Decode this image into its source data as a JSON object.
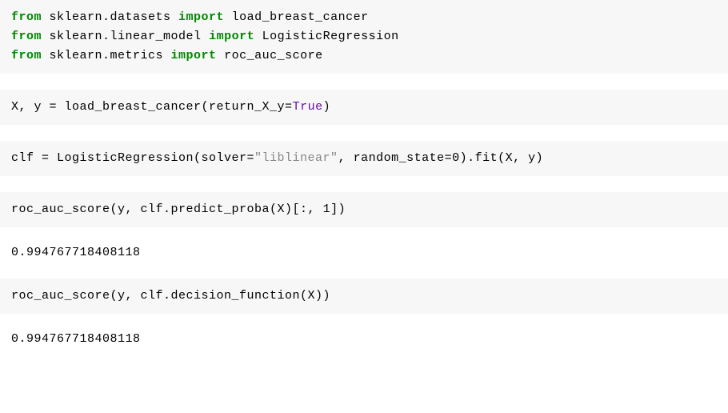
{
  "cell1": {
    "line1": {
      "kw_from1": "from",
      "mod1": " sklearn.datasets ",
      "kw_import1": "import",
      "name1": " load_breast_cancer"
    },
    "line2": {
      "kw_from2": "from",
      "mod2": " sklearn.linear_model ",
      "kw_import2": "import",
      "name2": " LogisticRegression"
    },
    "line3": {
      "kw_from3": "from",
      "mod3": " sklearn.metrics ",
      "kw_import3": "import",
      "name3": " roc_auc_score"
    }
  },
  "cell2": {
    "prefix": "X, y = load_breast_cancer(return_X_y=",
    "bool": "True",
    "suffix": ")"
  },
  "cell3": {
    "prefix": "clf = LogisticRegression(solver=",
    "str": "\"liblinear\"",
    "mid": ", random_state=",
    "num": "0",
    "suffix": ").fit(X, y)"
  },
  "cell4": {
    "prefix": "roc_auc_score(y, clf.predict_proba(X)[:, ",
    "num": "1",
    "suffix": "])"
  },
  "out4": "0.994767718408118",
  "cell5": {
    "code": "roc_auc_score(y, clf.decision_function(X))"
  },
  "out5": "0.994767718408118"
}
